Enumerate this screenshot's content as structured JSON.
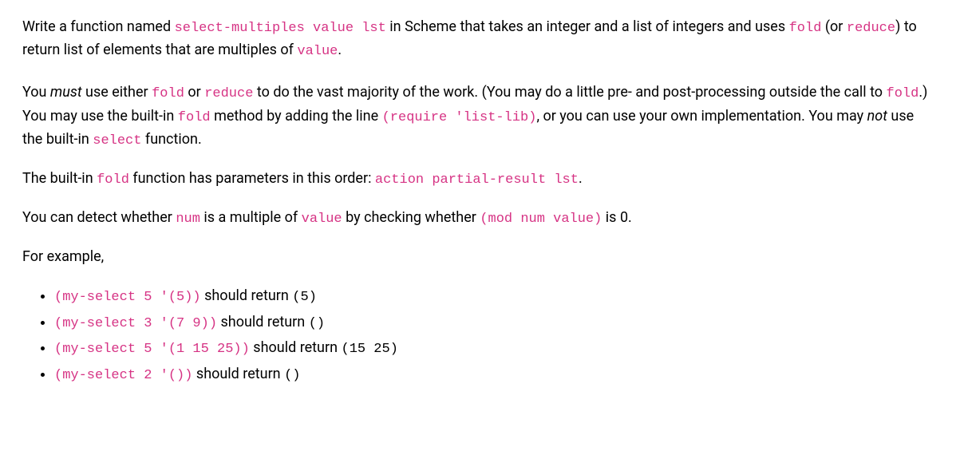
{
  "para1": {
    "t1": "Write a function named ",
    "c1": "select-multiples value lst",
    "t2": " in Scheme that takes an integer and a list of integers and uses ",
    "c2": "fold",
    "t3": " (or ",
    "c3": "reduce",
    "t4": ") to return list of elements that are multiples of ",
    "c4": "value",
    "t5": "."
  },
  "para2": {
    "t1": "You ",
    "em1": "must",
    "t2": " use either ",
    "c1": "fold",
    "t3": " or ",
    "c2": "reduce",
    "t4": " to do the vast majority of the work. (You may do a little pre- and post-processing outside the call to ",
    "c3": "fold",
    "t5": ".) You may use the built-in ",
    "c4": "fold",
    "t6": " method by adding the line ",
    "c5": "(require 'list-lib)",
    "t7": ", or you can use your own implementation. You may ",
    "em2": "not",
    "t8": " use the built-in ",
    "c6": "select",
    "t9": " function."
  },
  "para3": {
    "t1": "The built-in ",
    "c1": "fold",
    "t2": " function has parameters in this order: ",
    "c2": "action partial-result lst",
    "t3": "."
  },
  "para4": {
    "t1": "You can detect whether ",
    "c1": "num",
    "t2": " is a multiple of ",
    "c2": "value",
    "t3": " by checking whether ",
    "c3": "(mod num value)",
    "t4": " is 0."
  },
  "para5": {
    "t1": "For example,"
  },
  "examples": [
    {
      "call": "(my-select 5 '(5))",
      "mid": " should return ",
      "result": "(5)"
    },
    {
      "call": "(my-select 3 '(7 9))",
      "mid": " should return ",
      "result": "()"
    },
    {
      "call": "(my-select 5 '(1 15 25))",
      "mid": " should return ",
      "result": "(15 25)"
    },
    {
      "call": "(my-select 2 '())",
      "mid": " should return ",
      "result": "()"
    }
  ]
}
